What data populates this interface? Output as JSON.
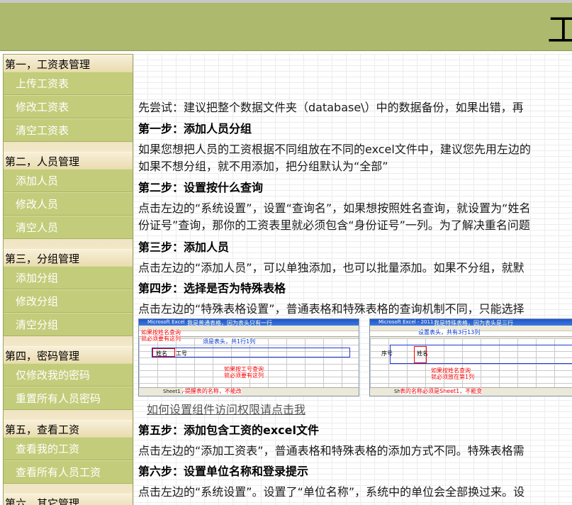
{
  "header": {
    "title": "工"
  },
  "sidebar": {
    "sections": [
      {
        "title": "第一，工资表管理",
        "items": [
          "上传工资表",
          "修改工资表",
          "清空工资表"
        ]
      },
      {
        "title": "第二，人员管理",
        "items": [
          "添加人员",
          "修改人员",
          "清空人员"
        ]
      },
      {
        "title": "第三，分组管理",
        "items": [
          "添加分组",
          "修改分组",
          "清空分组"
        ]
      },
      {
        "title": "第四，密码管理",
        "items": [
          "仅修改我的密码",
          "重置所有人员密码"
        ]
      },
      {
        "title": "第五，查看工资",
        "items": [
          "查看我的工资",
          "查看所有人员工资"
        ]
      },
      {
        "title": "第六，其它管理",
        "items": []
      }
    ]
  },
  "content": {
    "intro": "先尝试：建议把整个数据文件夹（database\\）中的数据备份，如果出错，再",
    "step1_title": "第一步：添加人员分组",
    "step1_text1": "如果您想把人员的工资根据不同组放在不同的excel文件中，建议您先用左边的",
    "step1_text2": "如果不想分组，就不用添加，把分组默认为“全部”",
    "step2_title": "第二步：设置按什么查询",
    "step2_text1": "点击左边的“系统设置”，设置“查询名”，如果想按照姓名查询，就设置为“姓名",
    "step2_text2": "份证号”查询，那你的工资表里就必须包含“身份证号”一列。为了解决重名问题",
    "step3_title": "第三步：添加人员",
    "step3_text": "点击左边的“添加人员”，可以单独添加，也可以批量添加。如果不分组，就默",
    "step4_title": "第四步：选择是否为特殊表格",
    "step4_text": "点击左边的“特殊表格设置”，普通表格和特殊表格的查询机制不同，只能选择",
    "link": "如何设置组件访问权限请点击我",
    "step5_title": "第五步：添加包含工资的excel文件",
    "step5_text": "点击左边的“添加工资表”，普通表格和特殊表格的添加方式不同。特殊表格需",
    "step6_title": "第六步：设置单位名称和登录提示",
    "step6_text": "点击左边的“系统设置”。设置了“单位名称”，系统中的单位会全部换过来。设"
  },
  "screenshots": {
    "left": {
      "app_title": "Microsoft Excel",
      "note_title": "我是普通表格，因为表头只有一行",
      "note_query": "如果按姓名查询",
      "note_required": "就必须要有这列",
      "note_header": "须是表头，共1行1列",
      "note_row": "如果按工号查询",
      "note_row2": "就必须要有这列",
      "note_sheet": "-提醒表的名称，不能改",
      "col_name": "姓名",
      "col_id": "工号",
      "sheet_tabs": "Sheet1 / Sheet2 / Sheet3"
    },
    "right": {
      "app_title": "Microsoft Excel - 2011",
      "note_title": "我是特殊表格，因为表头是三行",
      "note_header": "设置表头，共有3行13列",
      "note_query": "如果按姓名查询",
      "note_required": "就必须放在第1列",
      "note_sheet": "表的名称必须是Sheet1，不能变",
      "col_seq": "序号",
      "col_name": "姓名",
      "sheet_tabs": "Sheet1 / Sheet2 / Sheet3"
    }
  }
}
